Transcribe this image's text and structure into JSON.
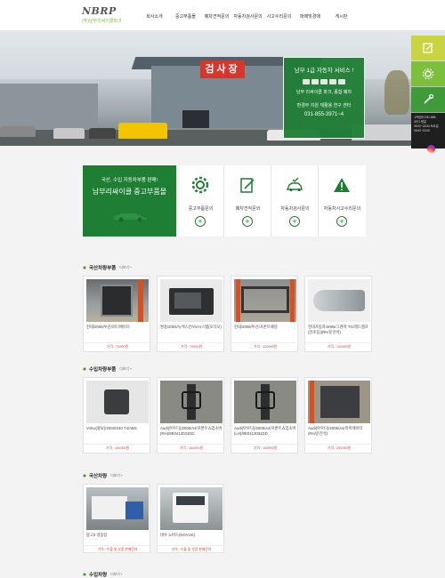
{
  "header": {
    "logo_text": "NBRP",
    "logo_sub": "(주)남부리싸이클파크",
    "nav": [
      "회사소개",
      "중고부품몰",
      "폐차견적문의",
      "자동차검사문의",
      "사고수리문의",
      "매매및경매",
      "게시판"
    ]
  },
  "hero": {
    "sign_text": "검사장",
    "panel_title": "남부 1급 자동차 서비스 !",
    "panel_line1": "남부 리싸이클 파크, 종합 폐차",
    "panel_line2": "환경부 지원 재활용 연구 센터",
    "panel_phone": "031-855-3971~4",
    "side_info": "고객센터 031-855-3971 평일 09:00~18:00 토요일 09:00~15:00"
  },
  "service": {
    "main_line1": "국산, 수입 자동차부품 판매!",
    "main_line2": "남부리싸이클 중고부품몰",
    "items": [
      {
        "label": "중고부품문의",
        "icon": "gear-icon"
      },
      {
        "label": "폐차견적문의",
        "icon": "document-edit-icon"
      },
      {
        "label": "자동차검사문의",
        "icon": "car-check-icon"
      },
      {
        "label": "자동차사고수리문의",
        "icon": "warning-icon"
      }
    ]
  },
  "sections": [
    {
      "title": "국산차량부품",
      "more": "더보기 +",
      "items": [
        {
          "name": "현대/2006/투산/라디에이터",
          "price": "가격 : 70000원"
        },
        {
          "name": "쌍용/2004/뉴렉스턴/AV시스템(오디오)",
          "price": "가격 : 70000원"
        },
        {
          "name": "현대/2006/투산/프론트패널",
          "price": "가격 : 120000원"
        },
        {
          "name": "현대자동차/2006/그랜저 TG/헤드램프(전조등)(RH/운전석)",
          "price": "가격 : 100000원"
        }
      ]
    },
    {
      "title": "수입차량부품",
      "more": "더보기 +",
      "items": [
        {
          "name": "Volvo(볼보)/2002/S40 T4/ABS",
          "price": "가격 : 150000원"
        },
        {
          "name": "Audi(아우디)/2005/A4/프론트쇼업소버(RH)/8E0413031DD",
          "price": "가격 : 150000원"
        },
        {
          "name": "Audi(아우디)/2005/A4/프론트쇼업소버(LH)/8E0413031DD",
          "price": "가격 : 150000원"
        },
        {
          "name": "Audi(아우디)/2005/A4/라이에이터(RH/운전석)",
          "price": "가격 : 250000원"
        }
      ]
    },
    {
      "title": "국산차량",
      "more": "더보기 +",
      "items": [
        {
          "name": "봉고3 냉동탑",
          "price": "가격 : 수출 및 부품 판매문의"
        },
        {
          "name": "대우 노버스(NOVUS)",
          "price": "가격 : 수출 및 부품 판매문의"
        }
      ]
    },
    {
      "title": "수입차량",
      "more": "더보기 +"
    }
  ]
}
